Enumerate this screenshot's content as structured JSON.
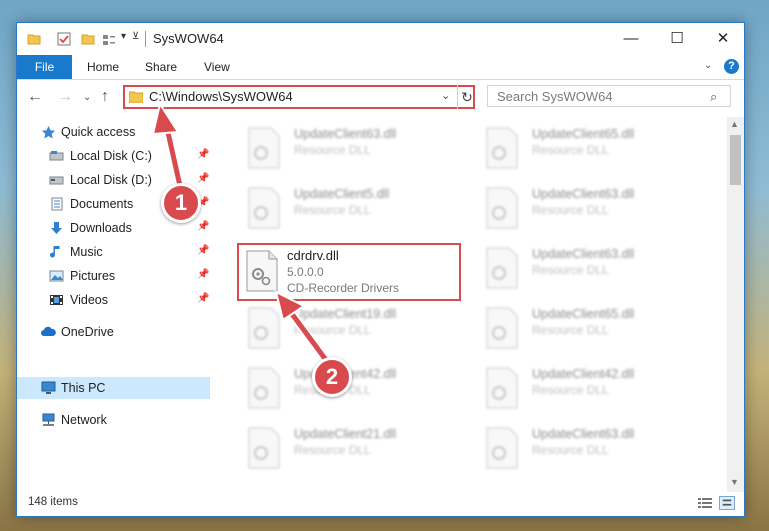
{
  "window": {
    "title": "SysWOW64",
    "minimize_glyph": "—",
    "maximize_glyph": "☐",
    "close_glyph": "✕"
  },
  "quick_access_toolbar": {
    "more_glyph": "▾",
    "customize_glyph": "⊻"
  },
  "ribbon": {
    "file_label": "File",
    "tabs": [
      "Home",
      "Share",
      "View"
    ],
    "expand_glyph": "⌄",
    "help_glyph": "?"
  },
  "navigation": {
    "back_glyph": "←",
    "forward_glyph": "→",
    "recent_glyph": "⌄",
    "up_glyph": "↑",
    "address_path": "C:\\Windows\\SysWOW64",
    "address_dropdown_glyph": "⌄",
    "refresh_glyph": "↻",
    "search_placeholder": "Search SysWOW64",
    "search_glyph": "⌕"
  },
  "sidebar": {
    "items": [
      {
        "label": "Quick access",
        "icon": "star-icon",
        "pinned": false
      },
      {
        "label": "Local Disk (C:)",
        "icon": "drive-icon",
        "pinned": true
      },
      {
        "label": "Local Disk (D:)",
        "icon": "drive-icon",
        "pinned": true
      },
      {
        "label": "Documents",
        "icon": "documents-icon",
        "pinned": true
      },
      {
        "label": "Downloads",
        "icon": "downloads-icon",
        "pinned": true
      },
      {
        "label": "Music",
        "icon": "music-icon",
        "pinned": true
      },
      {
        "label": "Pictures",
        "icon": "pictures-icon",
        "pinned": true
      },
      {
        "label": "Videos",
        "icon": "videos-icon",
        "pinned": true
      },
      {
        "label": "OneDrive",
        "icon": "onedrive-icon",
        "pinned": false
      },
      {
        "label": "This PC",
        "icon": "this-pc-icon",
        "pinned": false,
        "selected": true
      },
      {
        "label": "Network",
        "icon": "network-icon",
        "pinned": false
      }
    ],
    "pin_glyph": "📌"
  },
  "files": {
    "highlighted": {
      "name": "cdrdrv.dll",
      "version": "5.0.0.0",
      "description": "CD-Recorder Drivers"
    },
    "blurred": [
      {
        "name": "UpdateClient63.dll",
        "desc": "Resource DLL"
      },
      {
        "name": "UpdateClient65.dll",
        "desc": "Resource DLL"
      },
      {
        "name": "UpdateClient5.dll",
        "desc": "Resource DLL"
      },
      {
        "name": "UpdateClient63.dll",
        "desc": "Resource DLL"
      },
      {
        "name": "UpdateClient63.dll",
        "desc": "Resource DLL"
      },
      {
        "name": "UpdateClient19.dll",
        "desc": "Resource DLL"
      },
      {
        "name": "UpdateClient65.dll",
        "desc": "Resource DLL"
      },
      {
        "name": "UpdateClient42.dll",
        "desc": "Resource DLL"
      },
      {
        "name": "UpdateClient42.dll",
        "desc": "Resource DLL"
      },
      {
        "name": "UpdateClient21.dll",
        "desc": "Resource DLL"
      },
      {
        "name": "UpdateClient63.dll",
        "desc": "Resource DLL"
      }
    ]
  },
  "status": {
    "item_count": "148 items"
  },
  "callouts": {
    "step1": "1",
    "step2": "2"
  },
  "colors": {
    "accent": "#1979ca",
    "highlight_red": "#d94a4f",
    "selection": "#cce8ff"
  }
}
